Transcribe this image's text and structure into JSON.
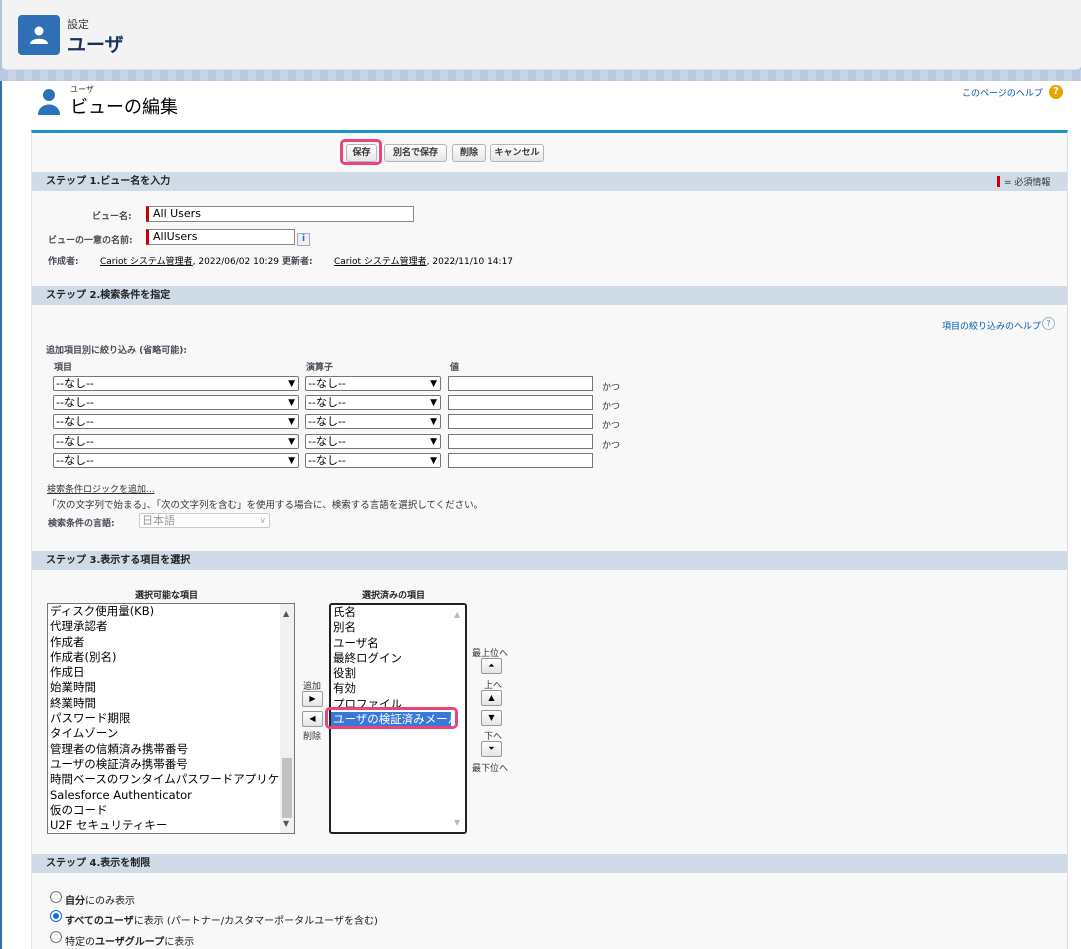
{
  "header": {
    "breadcrumb": "設定",
    "title": "ユーザ"
  },
  "page": {
    "object_type": "ユーザ",
    "title": "ビューの編集",
    "help_link": "このページのヘルプ"
  },
  "buttons": {
    "save": "保存",
    "save_as": "別名で保存",
    "delete": "削除",
    "cancel": "キャンセル"
  },
  "step1": {
    "heading": "ステップ 1.ビュー名を入力",
    "required_note": "= 必須情報",
    "view_name_label": "ビュー名:",
    "view_name_value": "All Users",
    "unique_name_label": "ビューの一意の名前:",
    "unique_name_value": "AllUsers",
    "info_icon": "i",
    "created_by_label": "作成者:",
    "created_by_user": "Cariot システム管理者",
    "created_date": ", 2022/06/02 10:29",
    "modified_by_label": "更新者:",
    "modified_by_user": "Cariot システム管理者",
    "modified_date": ", 2022/11/10 14:17"
  },
  "step2": {
    "heading": "ステップ 2.検索条件を指定",
    "filter_help": "項目の絞り込みのヘルプ",
    "filter_help_icon": "?",
    "filter_title": "追加項目別に絞り込み (省略可能):",
    "col_field": "項目",
    "col_operator": "演算子",
    "col_value": "値",
    "rows": [
      {
        "field": "--なし--",
        "operator": "--なし--",
        "value": "",
        "conj": "かつ"
      },
      {
        "field": "--なし--",
        "operator": "--なし--",
        "value": "",
        "conj": "かつ"
      },
      {
        "field": "--なし--",
        "operator": "--なし--",
        "value": "",
        "conj": "かつ"
      },
      {
        "field": "--なし--",
        "operator": "--なし--",
        "value": "",
        "conj": "かつ"
      },
      {
        "field": "--なし--",
        "operator": "--なし--",
        "value": "",
        "conj": ""
      }
    ],
    "add_logic_link": "検索条件ロジックを追加...",
    "language_note": "「次の文字列で始まる」、「次の文字列を含む」を使用する場合に、検索する言語を選択してください。",
    "language_label": "検索条件の言語:",
    "language_value": "日本語"
  },
  "step3": {
    "heading": "ステップ 3.表示する項目を選択",
    "available_title": "選択可能な項目",
    "selected_title": "選択済みの項目",
    "available": [
      "ディスク使用量(KB)",
      "代理承認者",
      "作成者",
      "作成者(別名)",
      "作成日",
      "始業時間",
      "終業時間",
      "パスワード期限",
      "タイムゾーン",
      "管理者の信頼済み携帯番号",
      "ユーザの検証済み携帯番号",
      "時間ベースのワンタイムパスワードアプリケーション",
      "Salesforce Authenticator",
      "仮のコード",
      "U2F セキュリティキー"
    ],
    "selected": [
      "氏名",
      "別名",
      "ユーザ名",
      "最終ログイン",
      "役割",
      "有効",
      "プロファイル",
      "ユーザの検証済みメール"
    ],
    "add_label": "追加",
    "remove_label": "削除",
    "top_label": "最上位へ",
    "up_label": "上へ",
    "down_label": "下へ",
    "bottom_label": "最下位へ"
  },
  "step4": {
    "heading": "ステップ 4.表示を制限",
    "options": [
      {
        "bold": "自分",
        "rest": "にのみ表示",
        "checked": false
      },
      {
        "bold": "すべてのユーザ",
        "rest": "に表示 (パートナー/カスタマーポータルユーザを含む)",
        "checked": true
      },
      {
        "pre": "特定の",
        "bold": "ユーザグループ",
        "rest": "に表示",
        "checked": false
      }
    ]
  },
  "colors": {
    "accent": "#1797c0",
    "highlight": "#e8457a",
    "section_bg": "#cfdbe7",
    "required": "#cc0000"
  }
}
